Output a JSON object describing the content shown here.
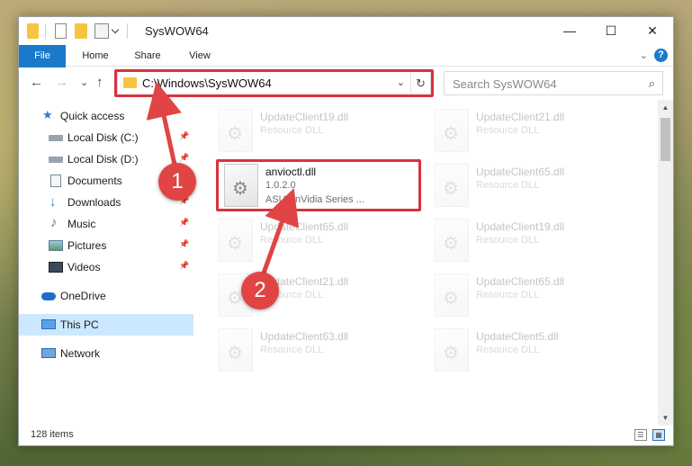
{
  "window": {
    "title": "SysWOW64",
    "minimize": "—",
    "maximize": "☐",
    "close": "✕"
  },
  "ribbon": {
    "tabs": [
      "File",
      "Home",
      "Share",
      "View"
    ],
    "collapse": "⌄",
    "help": "?"
  },
  "nav": {
    "back": "←",
    "forward": "→",
    "recent": "⌄",
    "up": "↑",
    "address": "C:\\Windows\\SysWOW64",
    "address_dropdown": "⌄",
    "refresh": "↻",
    "search_placeholder": "Search SysWOW64",
    "search_icon": "⌕"
  },
  "sidebar": {
    "items": [
      {
        "label": "Quick access",
        "icon": "star-icon",
        "pinned": false
      },
      {
        "label": "Local Disk (C:)",
        "icon": "drive-icon",
        "pinned": true
      },
      {
        "label": "Local Disk (D:)",
        "icon": "drive-icon",
        "pinned": true
      },
      {
        "label": "Documents",
        "icon": "documents-icon",
        "pinned": true
      },
      {
        "label": "Downloads",
        "icon": "downloads-icon",
        "pinned": true
      },
      {
        "label": "Music",
        "icon": "music-icon",
        "pinned": true
      },
      {
        "label": "Pictures",
        "icon": "pictures-icon",
        "pinned": true
      },
      {
        "label": "Videos",
        "icon": "videos-icon",
        "pinned": true
      },
      {
        "label": "OneDrive",
        "icon": "cloud-icon",
        "pinned": false
      },
      {
        "label": "This PC",
        "icon": "computer-icon",
        "pinned": false,
        "selected": true
      },
      {
        "label": "Network",
        "icon": "network-icon",
        "pinned": false
      }
    ]
  },
  "files": [
    {
      "name": "UpdateClient19.dll",
      "type": "Resource DLL",
      "faded": true
    },
    {
      "name": "UpdateClient21.dll",
      "type": "Resource DLL",
      "faded": true
    },
    {
      "name": "anvioctl.dll",
      "type": "1.0.2.0",
      "desc": "ASUS nVidia Series ...",
      "faded": false
    },
    {
      "name": "UpdateClient65.dll",
      "type": "Resource DLL",
      "faded": true
    },
    {
      "name": "UpdateClient65.dll",
      "type": "Resource DLL",
      "faded": true
    },
    {
      "name": "UpdateClient19.dll",
      "type": "Resource DLL",
      "faded": true
    },
    {
      "name": "UpdateClient21.dll",
      "type": "Resource DLL",
      "faded": true
    },
    {
      "name": "UpdateClient65.dll",
      "type": "Resource DLL",
      "faded": true
    },
    {
      "name": "UpdateClient63.dll",
      "type": "Resource DLL",
      "faded": true
    },
    {
      "name": "UpdateClient5.dll",
      "type": "Resource DLL",
      "faded": true
    }
  ],
  "status": {
    "item_count": "128 items"
  },
  "annotations": {
    "step1": "1",
    "step2": "2",
    "color": "#e14444"
  },
  "colors": {
    "accent": "#1979ca",
    "highlight": "#d9313d",
    "selected": "#cce8ff"
  }
}
